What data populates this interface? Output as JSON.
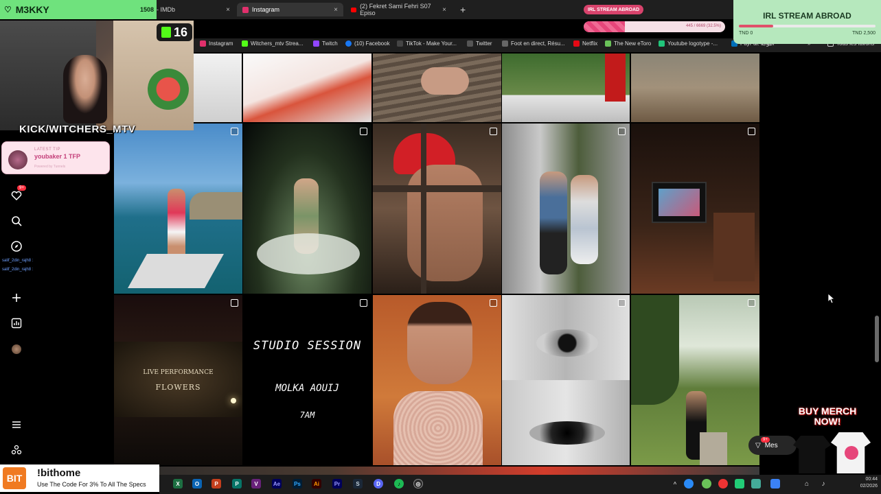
{
  "stream": {
    "channel": "M3KKY",
    "viewers": "16",
    "kick_handle": "KICK/WITCHERS_MTV",
    "tip_label": "LATEST TIP",
    "tip_text": "youbaker 1 TFP",
    "tip_caption": "Powered by Tunnels",
    "goal_tag": "IRL STREAM ABROAD",
    "goal_progress_text": "445 / 6669 (32.5%)",
    "goal_progress": 0.29,
    "irl_title": "IRL STREAM ABROAD",
    "irl_start": "TND 0",
    "irl_end": "TND 2,500",
    "irl_progress": 0.25,
    "chat": [
      "salif_2din_rajh8 :",
      "salif_2din_rajh8 :"
    ],
    "merch": "BUY MERCH NOW!"
  },
  "browser": {
    "counter": "1508",
    "tabs": [
      {
        "label": "lores - IMDb",
        "active": false
      },
      {
        "label": "Instagram",
        "active": true
      },
      {
        "label": "(2) Fekret Sami Fehri S07 Episo",
        "active": false
      }
    ],
    "new_tab": "+",
    "close": "×",
    "bookmarks": [
      {
        "label": "Instagram",
        "color": "#e1306c"
      },
      {
        "label": "Witchers_mtv Strea...",
        "color": "#53fc18"
      },
      {
        "label": "Twitch",
        "color": "#9146ff"
      },
      {
        "label": "(10) Facebook",
        "color": "#1877f2"
      },
      {
        "label": "TikTok - Make Your...",
        "color": "#111111"
      },
      {
        "label": "Twitter",
        "color": "#222222"
      },
      {
        "label": "Foot en direct, Résu...",
        "color": "#333333"
      },
      {
        "label": "Netflix",
        "color": "#e50914"
      },
      {
        "label": "The New eToro",
        "color": "#6ac259"
      },
      {
        "label": "Youtube logotype -...",
        "color": "#21c47a"
      },
      {
        "label": "PayPal: البوابة",
        "color": "#0070ba"
      }
    ],
    "all_favorites": "Tous les favoris"
  },
  "instagram": {
    "rail_icons": [
      "heart-icon",
      "search-icon",
      "explore-icon",
      "plus-icon",
      "dashboard-icon",
      "profile-icon",
      "menu-icon",
      "apps-icon"
    ],
    "notification_badge": "9+",
    "messages_badge": "9+",
    "messages_label": "Mes",
    "text_posts": {
      "studio_title": "STUDIO SESSION",
      "studio_artist": "MOLKA AOUIJ",
      "studio_time": "7AM",
      "live_title": "LIVE PERFORMANCE",
      "live_song": "FLOWERS"
    }
  },
  "bithome": {
    "logo": "BIT",
    "title": "!bithome",
    "subtitle": "Use The Code For 3% To All The Specs"
  },
  "taskbar": {
    "time": "00:44",
    "date": "02/2026"
  }
}
